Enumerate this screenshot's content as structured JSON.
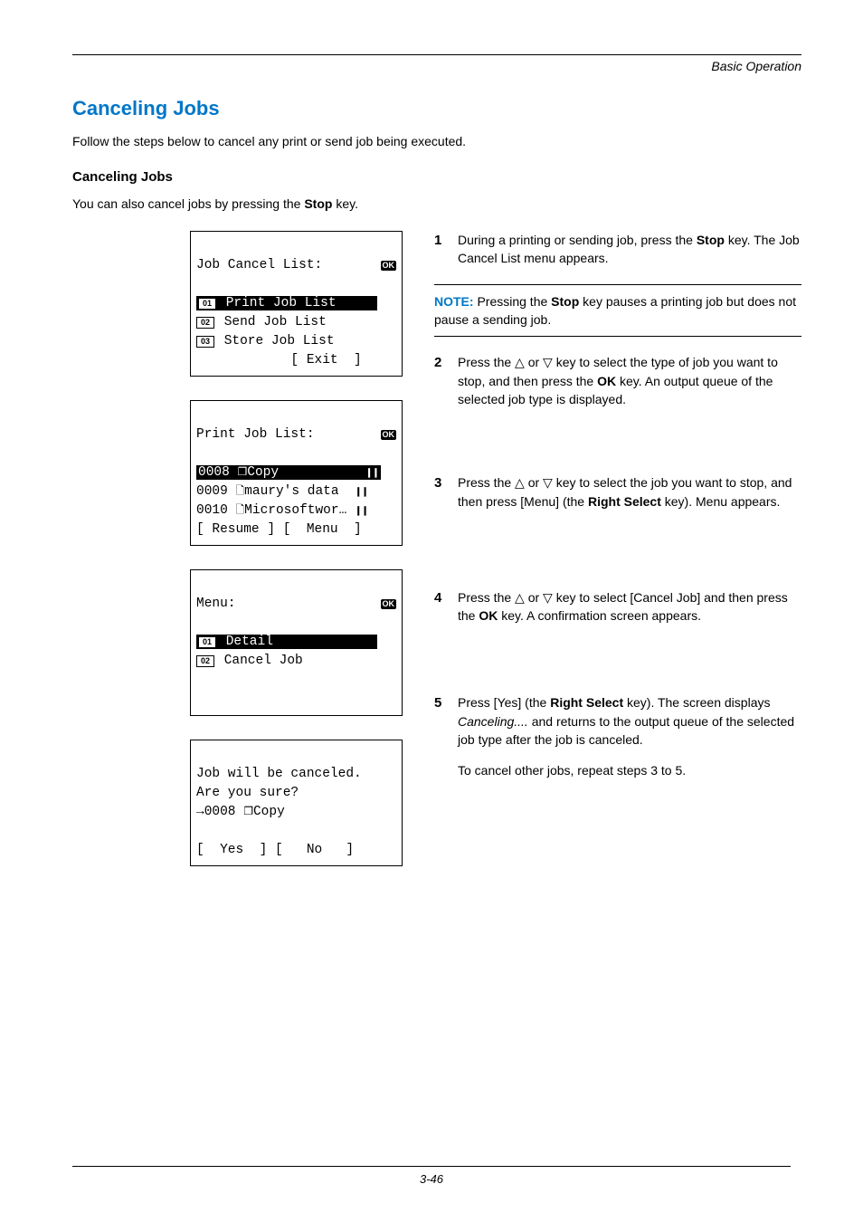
{
  "header": {
    "section_title": "Basic Operation"
  },
  "title": "Canceling Jobs",
  "intro": "Follow the steps below to cancel any print or send job being executed.",
  "subhead": "Canceling Jobs",
  "sub_intro_a": "You can also cancel jobs by pressing the ",
  "sub_intro_stop": "Stop",
  "sub_intro_b": " key.",
  "lcd1": {
    "title": "Job Cancel List:",
    "ok": "OK",
    "items": [
      {
        "badge": "01",
        "label": "Print Job List",
        "selected": true
      },
      {
        "badge": "02",
        "label": "Send Job List",
        "selected": false
      },
      {
        "badge": "03",
        "label": "Store Job List",
        "selected": false
      }
    ],
    "softkey_right": "[ Exit  ]"
  },
  "lcd2": {
    "title": "Print Job List:",
    "ok": "OK",
    "rows": [
      {
        "num": "0008",
        "icon": "stack",
        "label": "Copy",
        "selected": true,
        "pause": true
      },
      {
        "num": "0009",
        "icon": "doc",
        "label": "maury's data",
        "selected": false,
        "pause": true
      },
      {
        "num": "0010",
        "icon": "doc",
        "label": "Microsoftwor…",
        "selected": false,
        "pause": true
      }
    ],
    "softkeys": "[ Resume ] [  Menu  ]"
  },
  "lcd3": {
    "title": "Menu:",
    "ok": "OK",
    "items": [
      {
        "badge": "01",
        "label": "Detail",
        "selected": true
      },
      {
        "badge": "02",
        "label": "Cancel Job",
        "selected": false
      }
    ]
  },
  "lcd4": {
    "line1": "Job will be canceled.",
    "line2": "Are you sure?",
    "arrow_num": "0008",
    "arrow_icon": "stack",
    "arrow_label": "Copy",
    "softkeys": "[  Yes  ] [   No   ]"
  },
  "steps": {
    "s1a": "During a printing or sending job, press the ",
    "s1_stop": "Stop",
    "s1b": " key. The Job Cancel List menu appears.",
    "s2a": "Press the ",
    "s2b": " or ",
    "s2c": " key to select the type of job you want to stop, and then press the ",
    "s2_ok": "OK",
    "s2d": " key. An output queue of the selected job type is displayed.",
    "s3a": "Press the ",
    "s3b": " or ",
    "s3c": " key to select the job you want to stop, and then press [Menu] (the ",
    "s3_rs": "Right Select",
    "s3d": " key). Menu appears.",
    "s4a": "Press the ",
    "s4b": " or ",
    "s4c": " key to select [Cancel Job] and then press the ",
    "s4_ok": "OK",
    "s4d": " key. A confirmation screen appears.",
    "s5a": "Press [Yes] (the ",
    "s5_rs": "Right Select",
    "s5b": " key). The screen displays ",
    "s5_cancel": "Canceling....",
    "s5c": " and returns to the output queue of the selected job type after the job is canceled.",
    "s5_tail": "To cancel other jobs, repeat steps 3 to 5."
  },
  "note": {
    "label": "NOTE:",
    "a": " Pressing the ",
    "stop": "Stop",
    "b": " key pauses a printing job but does not pause a sending job."
  },
  "footer": {
    "page": "3-46"
  },
  "glyphs": {
    "tri_up": "△",
    "tri_down": "▽",
    "arrow_right": "→",
    "stack_icon": "❐",
    "doc_icon": "🗋",
    "pause": "❙❙"
  }
}
